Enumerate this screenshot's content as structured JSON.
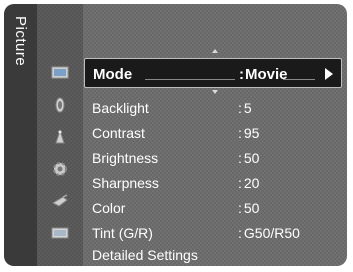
{
  "side_tab": {
    "label": "Picture"
  },
  "icons": [
    {
      "name": "picture-icon"
    },
    {
      "name": "sound-icon"
    },
    {
      "name": "channel-icon"
    },
    {
      "name": "setup-icon"
    },
    {
      "name": "input-icon"
    },
    {
      "name": "support-icon"
    }
  ],
  "menu": {
    "selected": {
      "label": "Mode",
      "value": "Movie"
    },
    "items": [
      {
        "label": "Backlight",
        "value": "5"
      },
      {
        "label": "Contrast",
        "value": "95"
      },
      {
        "label": "Brightness",
        "value": "50"
      },
      {
        "label": "Sharpness",
        "value": "20"
      },
      {
        "label": "Color",
        "value": "50"
      },
      {
        "label": "Tint (G/R)",
        "value": "G50/R50"
      },
      {
        "label": "Detailed Settings",
        "value": ""
      }
    ]
  }
}
